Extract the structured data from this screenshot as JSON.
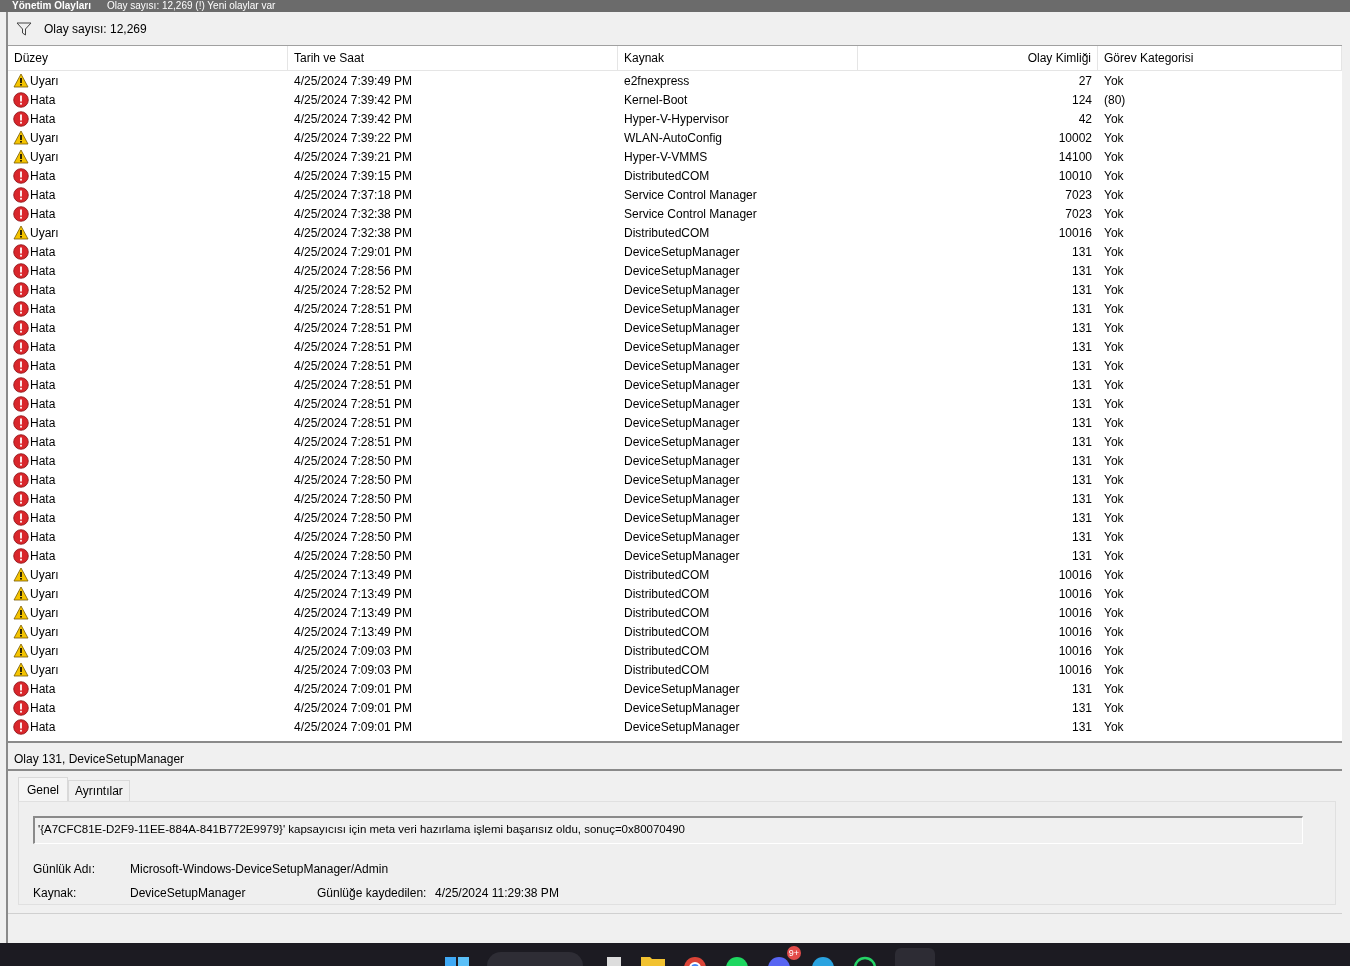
{
  "window": {
    "title": "Yönetim Olayları",
    "subtitle": "Olay sayısı: 12,269 (!) Yeni olaylar var"
  },
  "toolbar": {
    "count": "Olay sayısı: 12,269"
  },
  "table": {
    "columns": [
      "Düzey",
      "Tarih ve Saat",
      "Kaynak",
      "Olay Kimliği",
      "Görev Kategorisi"
    ],
    "rows": [
      {
        "kind": "warning",
        "level": "Uyarı",
        "date": "4/25/2024 7:39:49 PM",
        "source": "e2fnexpress",
        "id": "27",
        "category": "Yok"
      },
      {
        "kind": "error",
        "level": "Hata",
        "date": "4/25/2024 7:39:42 PM",
        "source": "Kernel-Boot",
        "id": "124",
        "category": "(80)"
      },
      {
        "kind": "error",
        "level": "Hata",
        "date": "4/25/2024 7:39:42 PM",
        "source": "Hyper-V-Hypervisor",
        "id": "42",
        "category": "Yok"
      },
      {
        "kind": "warning",
        "level": "Uyarı",
        "date": "4/25/2024 7:39:22 PM",
        "source": "WLAN-AutoConfig",
        "id": "10002",
        "category": "Yok"
      },
      {
        "kind": "warning",
        "level": "Uyarı",
        "date": "4/25/2024 7:39:21 PM",
        "source": "Hyper-V-VMMS",
        "id": "14100",
        "category": "Yok"
      },
      {
        "kind": "error",
        "level": "Hata",
        "date": "4/25/2024 7:39:15 PM",
        "source": "DistributedCOM",
        "id": "10010",
        "category": "Yok"
      },
      {
        "kind": "error",
        "level": "Hata",
        "date": "4/25/2024 7:37:18 PM",
        "source": "Service Control Manager",
        "id": "7023",
        "category": "Yok"
      },
      {
        "kind": "error",
        "level": "Hata",
        "date": "4/25/2024 7:32:38 PM",
        "source": "Service Control Manager",
        "id": "7023",
        "category": "Yok"
      },
      {
        "kind": "warning",
        "level": "Uyarı",
        "date": "4/25/2024 7:32:38 PM",
        "source": "DistributedCOM",
        "id": "10016",
        "category": "Yok"
      },
      {
        "kind": "error",
        "level": "Hata",
        "date": "4/25/2024 7:29:01 PM",
        "source": "DeviceSetupManager",
        "id": "131",
        "category": "Yok"
      },
      {
        "kind": "error",
        "level": "Hata",
        "date": "4/25/2024 7:28:56 PM",
        "source": "DeviceSetupManager",
        "id": "131",
        "category": "Yok"
      },
      {
        "kind": "error",
        "level": "Hata",
        "date": "4/25/2024 7:28:52 PM",
        "source": "DeviceSetupManager",
        "id": "131",
        "category": "Yok"
      },
      {
        "kind": "error",
        "level": "Hata",
        "date": "4/25/2024 7:28:51 PM",
        "source": "DeviceSetupManager",
        "id": "131",
        "category": "Yok"
      },
      {
        "kind": "error",
        "level": "Hata",
        "date": "4/25/2024 7:28:51 PM",
        "source": "DeviceSetupManager",
        "id": "131",
        "category": "Yok"
      },
      {
        "kind": "error",
        "level": "Hata",
        "date": "4/25/2024 7:28:51 PM",
        "source": "DeviceSetupManager",
        "id": "131",
        "category": "Yok"
      },
      {
        "kind": "error",
        "level": "Hata",
        "date": "4/25/2024 7:28:51 PM",
        "source": "DeviceSetupManager",
        "id": "131",
        "category": "Yok"
      },
      {
        "kind": "error",
        "level": "Hata",
        "date": "4/25/2024 7:28:51 PM",
        "source": "DeviceSetupManager",
        "id": "131",
        "category": "Yok"
      },
      {
        "kind": "error",
        "level": "Hata",
        "date": "4/25/2024 7:28:51 PM",
        "source": "DeviceSetupManager",
        "id": "131",
        "category": "Yok"
      },
      {
        "kind": "error",
        "level": "Hata",
        "date": "4/25/2024 7:28:51 PM",
        "source": "DeviceSetupManager",
        "id": "131",
        "category": "Yok"
      },
      {
        "kind": "error",
        "level": "Hata",
        "date": "4/25/2024 7:28:51 PM",
        "source": "DeviceSetupManager",
        "id": "131",
        "category": "Yok"
      },
      {
        "kind": "error",
        "level": "Hata",
        "date": "4/25/2024 7:28:50 PM",
        "source": "DeviceSetupManager",
        "id": "131",
        "category": "Yok"
      },
      {
        "kind": "error",
        "level": "Hata",
        "date": "4/25/2024 7:28:50 PM",
        "source": "DeviceSetupManager",
        "id": "131",
        "category": "Yok"
      },
      {
        "kind": "error",
        "level": "Hata",
        "date": "4/25/2024 7:28:50 PM",
        "source": "DeviceSetupManager",
        "id": "131",
        "category": "Yok"
      },
      {
        "kind": "error",
        "level": "Hata",
        "date": "4/25/2024 7:28:50 PM",
        "source": "DeviceSetupManager",
        "id": "131",
        "category": "Yok"
      },
      {
        "kind": "error",
        "level": "Hata",
        "date": "4/25/2024 7:28:50 PM",
        "source": "DeviceSetupManager",
        "id": "131",
        "category": "Yok"
      },
      {
        "kind": "error",
        "level": "Hata",
        "date": "4/25/2024 7:28:50 PM",
        "source": "DeviceSetupManager",
        "id": "131",
        "category": "Yok"
      },
      {
        "kind": "warning",
        "level": "Uyarı",
        "date": "4/25/2024 7:13:49 PM",
        "source": "DistributedCOM",
        "id": "10016",
        "category": "Yok"
      },
      {
        "kind": "warning",
        "level": "Uyarı",
        "date": "4/25/2024 7:13:49 PM",
        "source": "DistributedCOM",
        "id": "10016",
        "category": "Yok"
      },
      {
        "kind": "warning",
        "level": "Uyarı",
        "date": "4/25/2024 7:13:49 PM",
        "source": "DistributedCOM",
        "id": "10016",
        "category": "Yok"
      },
      {
        "kind": "warning",
        "level": "Uyarı",
        "date": "4/25/2024 7:13:49 PM",
        "source": "DistributedCOM",
        "id": "10016",
        "category": "Yok"
      },
      {
        "kind": "warning",
        "level": "Uyarı",
        "date": "4/25/2024 7:09:03 PM",
        "source": "DistributedCOM",
        "id": "10016",
        "category": "Yok"
      },
      {
        "kind": "warning",
        "level": "Uyarı",
        "date": "4/25/2024 7:09:03 PM",
        "source": "DistributedCOM",
        "id": "10016",
        "category": "Yok"
      },
      {
        "kind": "error",
        "level": "Hata",
        "date": "4/25/2024 7:09:01 PM",
        "source": "DeviceSetupManager",
        "id": "131",
        "category": "Yok"
      },
      {
        "kind": "error",
        "level": "Hata",
        "date": "4/25/2024 7:09:01 PM",
        "source": "DeviceSetupManager",
        "id": "131",
        "category": "Yok"
      },
      {
        "kind": "error",
        "level": "Hata",
        "date": "4/25/2024 7:09:01 PM",
        "source": "DeviceSetupManager",
        "id": "131",
        "category": "Yok"
      }
    ]
  },
  "details": {
    "title": "Olay 131, DeviceSetupManager",
    "tabs": [
      {
        "label": "Genel",
        "selected": true
      },
      {
        "label": "Ayrıntılar",
        "selected": false
      }
    ],
    "message": "'{A7CFC81E-D2F9-11EE-884A-841B772E9979}' kapsayıcısı için meta veri hazırlama işlemi başarısız oldu, sonuç=0x80070490",
    "log_name_label": "Günlük Adı:",
    "log_name": "Microsoft-Windows-DeviceSetupManager/Admin",
    "source_label": "Kaynak:",
    "source": "DeviceSetupManager",
    "logged_label": "Günlüğe kaydedilen:",
    "logged": "4/25/2024 11:29:38 PM"
  },
  "taskbar": {
    "badge": "9+"
  }
}
